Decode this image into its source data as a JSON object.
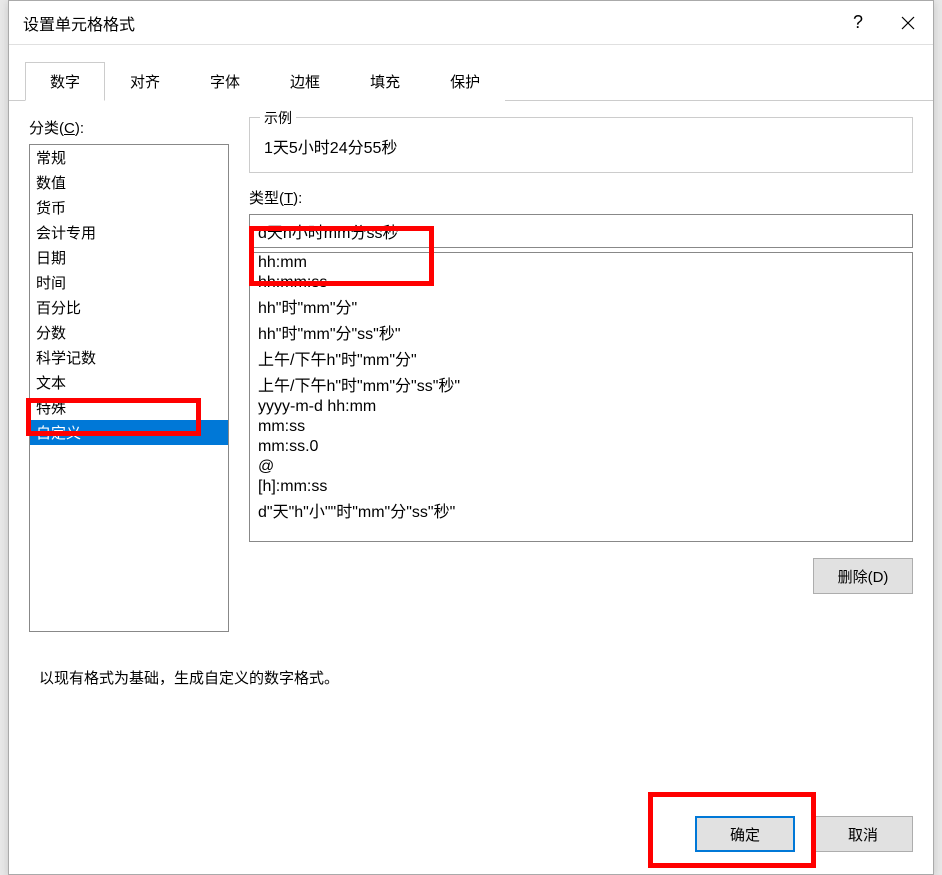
{
  "dialog": {
    "title": "设置单元格格式",
    "helpLabel": "?"
  },
  "tabs": [
    {
      "label": "数字",
      "active": true
    },
    {
      "label": "对齐",
      "active": false
    },
    {
      "label": "字体",
      "active": false
    },
    {
      "label": "边框",
      "active": false
    },
    {
      "label": "填充",
      "active": false
    },
    {
      "label": "保护",
      "active": false
    }
  ],
  "categoryLabelPrefix": "分类(",
  "categoryLabelKey": "C",
  "categoryLabelSuffix": "):",
  "categories": [
    "常规",
    "数值",
    "货币",
    "会计专用",
    "日期",
    "时间",
    "百分比",
    "分数",
    "科学记数",
    "文本",
    "特殊",
    "自定义"
  ],
  "selectedCategoryIndex": 11,
  "sample": {
    "legend": "示例",
    "value": "1天5小时24分55秒"
  },
  "typeLabelPrefix": "类型(",
  "typeLabelKey": "T",
  "typeLabelSuffix": "):",
  "typeValue": "d天h小时mm分ss秒",
  "formats": [
    "hh:mm",
    "hh:mm:ss",
    "hh\"时\"mm\"分\"",
    "hh\"时\"mm\"分\"ss\"秒\"",
    "上午/下午h\"时\"mm\"分\"",
    "上午/下午h\"时\"mm\"分\"ss\"秒\"",
    "yyyy-m-d hh:mm",
    "mm:ss",
    "mm:ss.0",
    "@",
    "[h]:mm:ss",
    "d\"天\"h\"小\"\"时\"mm\"分\"ss\"秒\""
  ],
  "deleteLabelPrefix": "删除(",
  "deleteLabelKey": "D",
  "deleteLabelSuffix": ")",
  "description": "以现有格式为基础，生成自定义的数字格式。",
  "footer": {
    "ok": "确定",
    "cancel": "取消"
  }
}
